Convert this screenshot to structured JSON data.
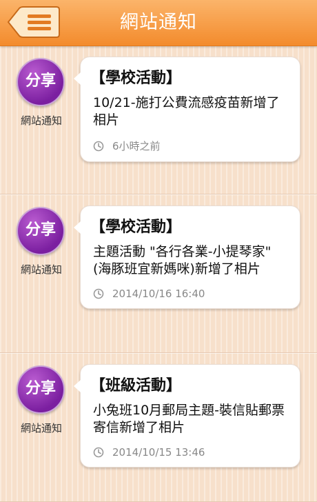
{
  "header": {
    "title": "網站通知",
    "menu_icon": "hamburger-menu-icon",
    "color_top": "#fbb46a",
    "color_bottom": "#f38b2c"
  },
  "feed": [
    {
      "badge": "分享",
      "source": "網站通知",
      "category": "【學校活動】",
      "message": "10/21-施打公費流感疫苗新增了相片",
      "time": "6小時之前"
    },
    {
      "badge": "分享",
      "source": "網站通知",
      "category": "【學校活動】",
      "message": "主題活動 \"各行各業-小提琴家\" (海豚班宜新媽咪)新增了相片",
      "time": "2014/10/16  16:40"
    },
    {
      "badge": "分享",
      "source": "網站通知",
      "category": "【班級活動】",
      "message": "小兔班10月郵局主題-裝信貼郵票寄信新增了相片",
      "time": "2014/10/15  13:46"
    }
  ]
}
